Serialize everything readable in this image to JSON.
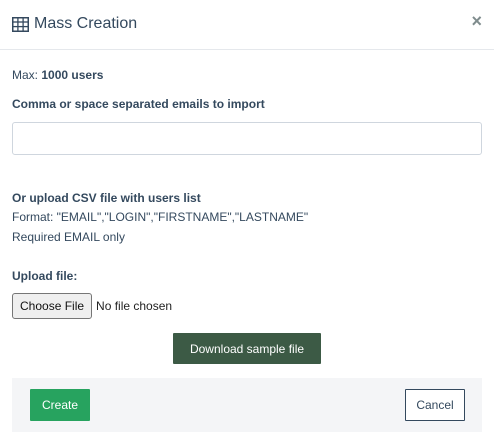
{
  "header": {
    "title": "Mass Creation",
    "title_icon": "table-icon",
    "close_label": "×"
  },
  "limits": {
    "max_label": "Max:",
    "max_value": "1000 users"
  },
  "emails": {
    "label": "Comma or space separated emails to import",
    "value": "",
    "placeholder": ""
  },
  "csv": {
    "heading": "Or upload CSV file with users list",
    "format_text": "Format: \"EMAIL\",\"LOGIN\",\"FIRSTNAME\",\"LASTNAME\"",
    "required_text": "Required EMAIL only"
  },
  "upload": {
    "label": "Upload file:",
    "button_label": "Choose File",
    "status": "No file chosen"
  },
  "download_label": "Download sample file",
  "footer": {
    "create_label": "Create",
    "cancel_label": "Cancel"
  },
  "colors": {
    "text": "#34495e",
    "download_bg": "#3c5a45",
    "create_bg": "#27a35f",
    "footer_bg": "#f4f5f7"
  }
}
